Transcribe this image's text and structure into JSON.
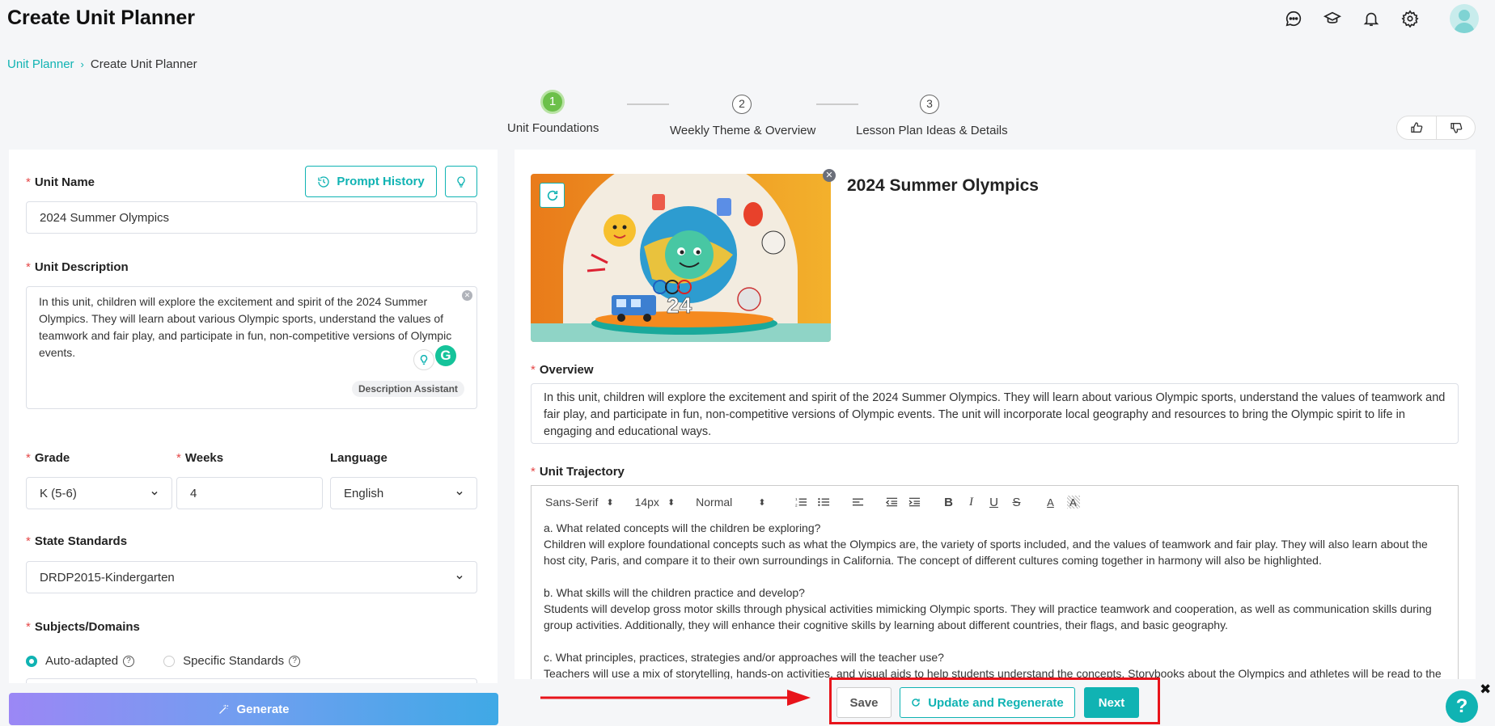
{
  "header": {
    "title": "Create Unit Planner",
    "icons": [
      "chat-icon",
      "graduation-cap-icon",
      "bell-icon",
      "gear-icon",
      "avatar"
    ]
  },
  "breadcrumb": {
    "link": "Unit Planner",
    "current": "Create Unit Planner"
  },
  "steps": [
    {
      "number": "1",
      "label": "Unit Foundations",
      "active": true
    },
    {
      "number": "2",
      "label": "Weekly Theme & Overview",
      "active": false
    },
    {
      "number": "3",
      "label": "Lesson Plan Ideas & Details",
      "active": false
    }
  ],
  "left": {
    "unit_name_label": "Unit Name",
    "prompt_history_label": "Prompt History",
    "unit_name_value": "2024 Summer Olympics",
    "unit_description_label": "Unit Description",
    "unit_description_value": "In this unit, children will explore the excitement and spirit of the 2024 Summer Olympics. They will learn about various Olympic sports, understand the values of teamwork and fair play, and participate in fun, non-competitive versions of Olympic events.",
    "description_assistant_label": "Description Assistant",
    "grade_label": "Grade",
    "grade_value": "K (5-6)",
    "weeks_label": "Weeks",
    "weeks_value": "4",
    "language_label": "Language",
    "language_value": "English",
    "state_standards_label": "State Standards",
    "state_standards_value": "DRDP2015-Kindergarten",
    "subjects_label": "Subjects/Domains",
    "radio_auto_label": "Auto-adapted",
    "radio_specific_label": "Specific Standards",
    "generate_label": "Generate"
  },
  "right": {
    "unit_title": "2024 Summer Olympics",
    "overview_label": "Overview",
    "overview_value": "In this unit, children will explore the excitement and spirit of the 2024 Summer Olympics. They will learn about various Olympic sports, understand the values of teamwork and fair play, and participate in fun, non-competitive versions of Olympic events. The unit will incorporate local geography and resources to bring the Olympic spirit to life in engaging and educational ways.",
    "trajectory_label": "Unit Trajectory",
    "toolbar": {
      "font": "Sans-Serif",
      "size": "14px",
      "style": "Normal"
    },
    "trajectory": {
      "q1": "a. What related concepts will the children be exploring?",
      "a1": "Children will explore foundational concepts such as what the Olympics are, the variety of sports included, and the values of teamwork and fair play. They will also learn about the host city, Paris, and compare it to their own surroundings in California. The concept of different cultures coming together in harmony will also be highlighted.",
      "q2": "b. What skills will the children practice and develop?",
      "a2": "Students will develop gross motor skills through physical activities mimicking Olympic sports. They will practice teamwork and cooperation, as well as communication skills during group activities. Additionally, they will enhance their cognitive skills by learning about different countries, their flags, and basic geography.",
      "q3": "c. What principles, practices, strategies and/or approaches will the teacher use?",
      "a3": "Teachers will use a mix of storytelling, hands-on activities, and visual aids to help students understand the concepts. Storybooks about the Olympics and athletes will be read to the"
    }
  },
  "actions": {
    "save_label": "Save",
    "update_label": "Update and Regenerate",
    "next_label": "Next"
  },
  "help": {
    "label": "?",
    "close": "✖"
  },
  "colors": {
    "accent": "#10b3b3",
    "step_active": "#6cc04a",
    "highlight_box": "#e8141b",
    "required": "#e54848"
  }
}
